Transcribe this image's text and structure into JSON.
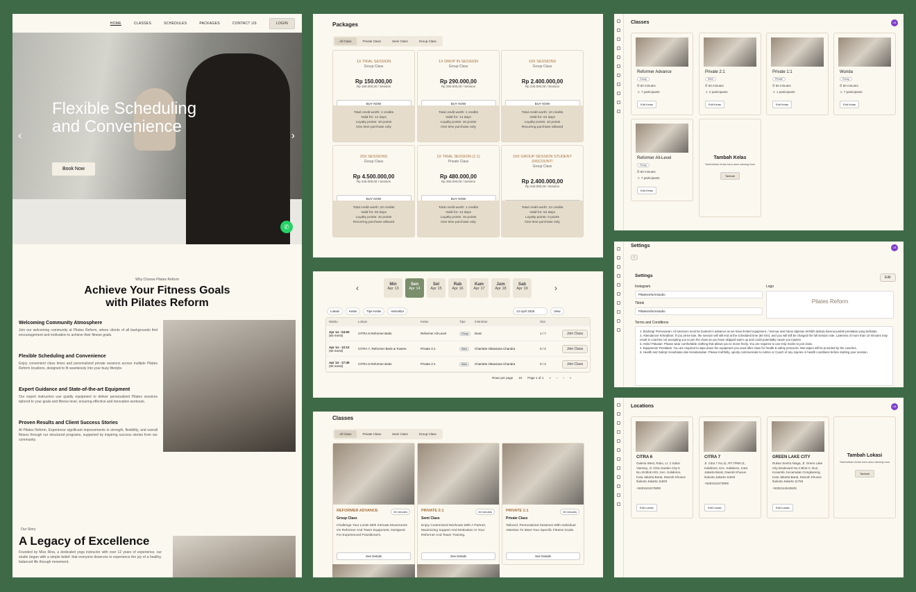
{
  "landing": {
    "nav": [
      "HOME",
      "CLASSES",
      "SCHEDULES",
      "PACKAGES",
      "CONTACT US"
    ],
    "login": "LOGIN",
    "hero_title": "Flexible Scheduling and Convenience",
    "hero_button": "Book Now",
    "why_kicker": "Why Choose Pilates Reform",
    "why_title": "Achieve Your Fitness Goals with Pilates Reform",
    "features": [
      {
        "title": "Welcoming Community Atmosphere",
        "text": "Join our welcoming community at Pilates Reform, where clients of all backgrounds find encouragement and motivation to achieve their fitness goals."
      },
      {
        "title": "Flexible Scheduling and Convenience",
        "text": "Enjoy convenient class times and personalized private sessions across multiple Pilates Reform locations, designed to fit seamlessly into your busy lifestyle."
      },
      {
        "title": "Expert Guidance and State-of-the-art Equipment",
        "text": "Our expert instructors use quality equipment to deliver personalized Pilates sessions tailored to your goals and fitness level, ensuring effective and innovative workouts."
      },
      {
        "title": "Proven Results and Client Success Stories",
        "text": "At Pilates Reform, Experience significant improvements in strength, flexibility, and overall fitness through our structured programs, supported by inspiring success stories from our community."
      }
    ],
    "story_kicker": "Our Story",
    "story_title": "A Legacy of Excellence",
    "story_text": "Founded by Miss Rina, a dedicated yoga instructor with over 12 years of experience, our studio began with a simple belief: that everyone deserves to experience the joy of a healthy, balanced life through movement."
  },
  "packages": {
    "title": "Packages",
    "tabs": [
      "All Class",
      "Private Class",
      "Semi Class",
      "Group Class"
    ],
    "buy_label": "BUY NOW",
    "items": [
      {
        "name": "1X TRIAL SESSION",
        "type": "Group Class",
        "price": "Rp 150.000,00",
        "per": "Rp 150.000,00 / Session",
        "details": [
          "Total credit worth: 1 credits",
          "Valid for: 14 days",
          "Loyalty points: 10 points",
          "One time purchase only"
        ]
      },
      {
        "name": "1X DROP IN SESSION",
        "type": "Group Class",
        "price": "Rp 290.000,00",
        "per": "Rp 290.000,00 / Session",
        "details": [
          "Total credit worth: 1 credits",
          "Valid for: 14 days",
          "Loyalty points: 10 points",
          "One time purchase only"
        ]
      },
      {
        "name": "10X SESSIONS",
        "type": "Group Class",
        "price": "Rp 2.400.000,00",
        "per": "Rp 240.000,00 / Session",
        "details": [
          "Total credit worth: 10 credits",
          "Valid for: 62 days",
          "Loyalty points: 10 points",
          "Recurring purchase allowed"
        ]
      },
      {
        "name": "20X SESSIONS",
        "type": "Group Class",
        "price": "Rp 4.500.000,00",
        "per": "Rp 225.000,00 / Session",
        "details": [
          "Total credit worth: 20 credits",
          "Valid for: 93 days",
          "Loyalty points: 10 points",
          "Recurring purchase allowed"
        ]
      },
      {
        "name": "1X TRIAL SESSION (1:1)",
        "type": "Private Class",
        "price": "Rp 480.000,00",
        "per": "Rp 480.000,00 / Session",
        "details": [
          "Total credit worth: 1 credits",
          "Valid for: 14 days",
          "Loyalty points: 10 points",
          "One time purchase only"
        ]
      },
      {
        "name": "10X GROUP SESSION STUDENT DISCOUNT!",
        "type": "Group Class",
        "price": "Rp 2.400.000,00",
        "per": "Rp 240.000,00 / Session",
        "details": [
          "Total credit worth: 10 credits",
          "Valid for: 62 days",
          "Loyalty points: 0 points",
          "One time purchase only"
        ]
      }
    ]
  },
  "schedule": {
    "days": [
      {
        "d": "Min",
        "dt": "Apr 13"
      },
      {
        "d": "Sen",
        "dt": "Apr 14"
      },
      {
        "d": "Sel",
        "dt": "Apr 15"
      },
      {
        "d": "Rab",
        "dt": "Apr 16"
      },
      {
        "d": "Kam",
        "dt": "Apr 17"
      },
      {
        "d": "Jum",
        "dt": "Apr 18"
      },
      {
        "d": "Sab",
        "dt": "Apr 19"
      }
    ],
    "filters": [
      "Lokasi",
      "Kelas",
      "Tipe Kelas",
      "Instruktur"
    ],
    "date": "14 April 2025",
    "view": "View",
    "headers": [
      "Waktu",
      "Lokasi",
      "Kelas",
      "Tipe",
      "Instruktur",
      "Slot"
    ],
    "rows": [
      {
        "time": "Apr 14 - 04:00",
        "dur": "(60 menit)",
        "loc": "CITRA 6 Reformer Beds",
        "cls": "Reformer All-Level",
        "type": "Group",
        "ins": "Dewi",
        "slot": "1 / 7"
      },
      {
        "time": "Apr 14 - 12:12",
        "dur": "(60 menit)",
        "loc": "CITRA 7, Reformer Beds & Towers",
        "cls": "Private 2:1",
        "type": "Semi",
        "ins": "Charlotte Oktaviana Chandra",
        "slot": "0 / 2"
      },
      {
        "time": "Apr 14 - 17:45",
        "dur": "(60 menit)",
        "loc": "CITRA 6 Reformer Beds",
        "cls": "Private 2:1",
        "type": "Semi",
        "ins": "Charlotte Oktaviana Chandra",
        "slot": "0 / 2"
      }
    ],
    "join": "Join Class",
    "rows_per_page": "Rows per page",
    "rpp_value": "10",
    "page": "Page 1 of 1"
  },
  "classes_public": {
    "title": "Classes",
    "tabs": [
      "All Class",
      "Private Class",
      "Semi Class",
      "Group Class"
    ],
    "see": "See Details",
    "items": [
      {
        "name": "REFORMER ADVANCE",
        "dur": "60 minutes",
        "type": "Group Class",
        "desc": "Challenge Your Limits With Intricate Movements On Reformer And Tower Equipment, Designed For Experienced Practitioners."
      },
      {
        "name": "PRIVATE 2:1",
        "dur": "60 minutes",
        "type": "Semi Class",
        "desc": "Enjoy Customized Workouts With A Partner, Maximizing Support And Motivation In Your Reformer And Tower Training."
      },
      {
        "name": "PRIVATE 1:1",
        "dur": "60 minutes",
        "type": "Private Class",
        "desc": "Tailored, Personalized Sessions With Individual Attention To Meet Your Specific Fitness Goals."
      }
    ]
  },
  "admin_classes": {
    "title": "Classes",
    "avatar": "LB",
    "edit": "Edit Kelas",
    "items": [
      {
        "name": "Reformer Advance",
        "badge": "Group",
        "dur": "60 minutes",
        "part": "7 participants"
      },
      {
        "name": "Private 2:1",
        "badge": "Semi",
        "dur": "60 minutes",
        "part": "2 participants"
      },
      {
        "name": "Private 1:1",
        "badge": "Private",
        "dur": "60 minutes",
        "part": "1 participants"
      },
      {
        "name": "Wunda",
        "badge": "Group",
        "dur": "60 minutes",
        "part": "7 participants"
      },
      {
        "name": "Reformer All-Level",
        "badge": "Group",
        "dur": "60 minutes",
        "part": "7 participants"
      }
    ],
    "add_title": "Tambah Kelas",
    "add_sub": "Tambahkan kelas baru atau cabang baru",
    "add_btn": "Tambah"
  },
  "settings": {
    "title": "Settings",
    "back": "‹",
    "sub": "Settings",
    "edit": "Edit",
    "instagram_label": "Instagram",
    "instagram": "Pilatesreformstudio",
    "tiktok_label": "Tiktok",
    "tiktok": "Pilatesreformstudio",
    "logo_label": "Logo",
    "logo_text": "Pilates Reform",
    "terms_label": "Terms and Conditions",
    "terms": [
      "1. Booking/ Pemesanan: All sessions must be booked in advance as we have limited equipment. / Semua sesi harus dipesan terlebih dahulu karena jumlah peralatan yang terbatas.",
      "2. Attendance/ Kehadiran: If you arrive late, the session will still end at the scheduled time (60 min), and you will still be charged the full session rate. Lateness of more than 10 minutes may result in coaches not accepting you to join the class as you have skipped warm up and could potentially cause you injuries.",
      "3. Attire/ Pakaian: Please wear comfortable clothing that allows you to move freely. You are requires to use Grip Socks to join class.",
      "4. Equipment/ Peralatan: You are required to wipe down the equipment you used after class for health & safety protocols. Wet wipes will be provided by the coaches.",
      "5. Health and Safety/ Kesehatan dan Keselamatan: Please truthfully, openly communicate to Admin or Coach of any injuries or health conditions before starting your session."
    ]
  },
  "locations": {
    "title": "Locations",
    "edit": "Edit Lokasi",
    "items": [
      {
        "name": "CITRA 6",
        "addr": "Galeria West, Ruko, Lt. 2 Salon Vianney, Jl. Citra Garden City 6 No.19 Blok H01, Kec. Kalideres, Kota Jakarta Barat, Daerah Khusus Ibukota Jakarta 11820",
        "phone": "+6281511673808"
      },
      {
        "name": "CITRA 7",
        "addr": "Jl. Citra 7 No.11, RT.7/RW.11, Kalideres, Kec. Kalideres, Kota Jakarta Barat, Daerah Khusus Ibukota Jakarta 11840",
        "phone": "+6281511673808"
      },
      {
        "name": "GREEN LAKE CITY",
        "addr": "Rukan Sentra Niaga, Jl. Green Lake City Boulevard No.2 Blok H, Duri, Kosambi, Kecamatan Cengkareng, Kota Jakarta Barat, Daerah Khusus Ibukota Jakarta 11750",
        "phone": "+6282114543625"
      }
    ],
    "add_title": "Tambah Lokasi",
    "add_sub": "Tambahkan kelas baru atau cabang baru",
    "add_btn": "Tambah"
  },
  "colors": {
    "bg": "#3f6a48",
    "panel": "#fbf8ef",
    "accent": "#a5703a",
    "selected_day": "#7b8e6c",
    "avatar": "#7d3ec8"
  }
}
